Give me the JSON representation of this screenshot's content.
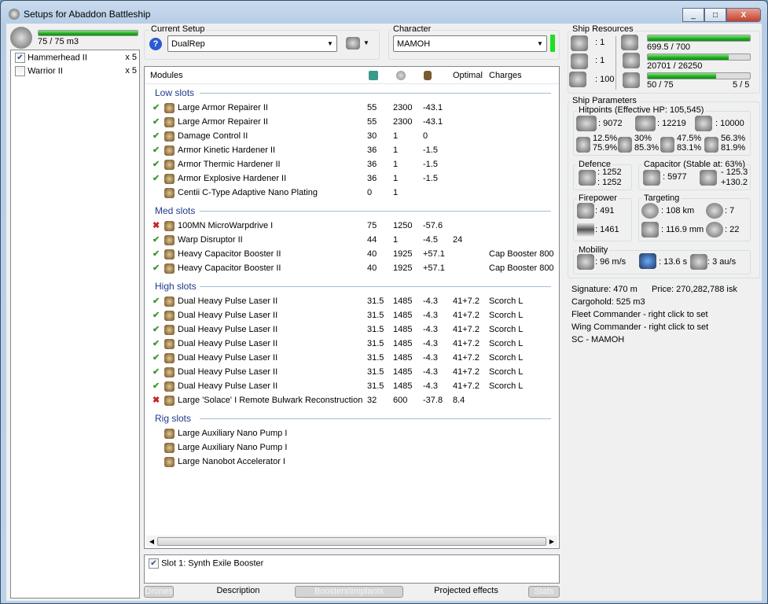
{
  "window": {
    "title": "Setups for Abaddon Battleship",
    "min": "_",
    "max": "□",
    "close": "X"
  },
  "drone_bay": {
    "usage": "75 / 75 m3",
    "fill": 1.0,
    "items": [
      {
        "name": "Hammerhead II",
        "qty": "x 5",
        "checked": true
      },
      {
        "name": "Warrior II",
        "qty": "x 5",
        "checked": false
      }
    ]
  },
  "setup": {
    "label": "Current Setup",
    "value": "DualRep",
    "help": "?"
  },
  "character": {
    "label": "Character",
    "value": "MAMOH"
  },
  "modules": {
    "header": {
      "name": "Modules",
      "optimal": "Optimal",
      "charges": "Charges"
    },
    "sections": [
      {
        "title": "Low slots",
        "rows": [
          {
            "s": "ok",
            "n": "Large Armor Repairer II",
            "cpu": "55",
            "pg": "2300",
            "cap": "-43.1",
            "opt": "",
            "ch": ""
          },
          {
            "s": "ok",
            "n": "Large Armor Repairer II",
            "cpu": "55",
            "pg": "2300",
            "cap": "-43.1",
            "opt": "",
            "ch": ""
          },
          {
            "s": "ok",
            "n": "Damage Control II",
            "cpu": "30",
            "pg": "1",
            "cap": "0",
            "opt": "",
            "ch": ""
          },
          {
            "s": "ok",
            "n": "Armor Kinetic Hardener II",
            "cpu": "36",
            "pg": "1",
            "cap": "-1.5",
            "opt": "",
            "ch": ""
          },
          {
            "s": "ok",
            "n": "Armor Thermic Hardener II",
            "cpu": "36",
            "pg": "1",
            "cap": "-1.5",
            "opt": "",
            "ch": ""
          },
          {
            "s": "ok",
            "n": "Armor Explosive Hardener II",
            "cpu": "36",
            "pg": "1",
            "cap": "-1.5",
            "opt": "",
            "ch": ""
          },
          {
            "s": "",
            "n": "Centii C-Type Adaptive Nano Plating",
            "cpu": "0",
            "pg": "1",
            "cap": "",
            "opt": "",
            "ch": ""
          }
        ]
      },
      {
        "title": "Med slots",
        "rows": [
          {
            "s": "bad",
            "n": "100MN MicroWarpdrive I",
            "cpu": "75",
            "pg": "1250",
            "cap": "-57.6",
            "opt": "",
            "ch": ""
          },
          {
            "s": "ok",
            "n": "Warp Disruptor II",
            "cpu": "44",
            "pg": "1",
            "cap": "-4.5",
            "opt": "24",
            "ch": ""
          },
          {
            "s": "ok",
            "n": "Heavy Capacitor Booster II",
            "cpu": "40",
            "pg": "1925",
            "cap": "+57.1",
            "opt": "",
            "ch": "Cap Booster 800"
          },
          {
            "s": "ok",
            "n": "Heavy Capacitor Booster II",
            "cpu": "40",
            "pg": "1925",
            "cap": "+57.1",
            "opt": "",
            "ch": "Cap Booster 800"
          }
        ]
      },
      {
        "title": "High slots",
        "rows": [
          {
            "s": "ok",
            "n": "Dual Heavy Pulse Laser II",
            "cpu": "31.5",
            "pg": "1485",
            "cap": "-4.3",
            "opt": "41+7.2",
            "ch": "Scorch L"
          },
          {
            "s": "ok",
            "n": "Dual Heavy Pulse Laser II",
            "cpu": "31.5",
            "pg": "1485",
            "cap": "-4.3",
            "opt": "41+7.2",
            "ch": "Scorch L"
          },
          {
            "s": "ok",
            "n": "Dual Heavy Pulse Laser II",
            "cpu": "31.5",
            "pg": "1485",
            "cap": "-4.3",
            "opt": "41+7.2",
            "ch": "Scorch L"
          },
          {
            "s": "ok",
            "n": "Dual Heavy Pulse Laser II",
            "cpu": "31.5",
            "pg": "1485",
            "cap": "-4.3",
            "opt": "41+7.2",
            "ch": "Scorch L"
          },
          {
            "s": "ok",
            "n": "Dual Heavy Pulse Laser II",
            "cpu": "31.5",
            "pg": "1485",
            "cap": "-4.3",
            "opt": "41+7.2",
            "ch": "Scorch L"
          },
          {
            "s": "ok",
            "n": "Dual Heavy Pulse Laser II",
            "cpu": "31.5",
            "pg": "1485",
            "cap": "-4.3",
            "opt": "41+7.2",
            "ch": "Scorch L"
          },
          {
            "s": "ok",
            "n": "Dual Heavy Pulse Laser II",
            "cpu": "31.5",
            "pg": "1485",
            "cap": "-4.3",
            "opt": "41+7.2",
            "ch": "Scorch L"
          },
          {
            "s": "bad",
            "n": "Large 'Solace' I Remote Bulwark Reconstruction",
            "cpu": "32",
            "pg": "600",
            "cap": "-37.8",
            "opt": "8.4",
            "ch": ""
          }
        ]
      },
      {
        "title": "Rig slots",
        "rows": [
          {
            "s": "",
            "n": "Large Auxiliary Nano Pump I",
            "cpu": "",
            "pg": "",
            "cap": "",
            "opt": "",
            "ch": ""
          },
          {
            "s": "",
            "n": "Large Auxiliary Nano Pump I",
            "cpu": "",
            "pg": "",
            "cap": "",
            "opt": "",
            "ch": ""
          },
          {
            "s": "",
            "n": "Large Nanobot Accelerator I",
            "cpu": "",
            "pg": "",
            "cap": "",
            "opt": "",
            "ch": ""
          }
        ]
      }
    ]
  },
  "boosters": {
    "item": "Slot 1: Synth Exile Booster",
    "checked": true
  },
  "tabs": [
    "Drones",
    "Description",
    "Boosters\\Implants",
    "Projected effects",
    "Stats"
  ],
  "resources": {
    "title": "Ship Resources",
    "turrets": ": 1",
    "launchers": ": 1",
    "calibration": ": 100",
    "cpu": "699.5 / 700",
    "cpu_fill": 0.999,
    "pg": "20701 / 26250",
    "pg_fill": 0.789,
    "drones": "50 / 75",
    "drones_fill": 0.667,
    "drone_count": "5 / 5"
  },
  "params": {
    "title": "Ship Parameters",
    "hp_title": "Hitpoints (Effective HP: 105,545)",
    "shield": ": 9072",
    "armor": ": 12219",
    "structure": ": 10000",
    "resists": [
      {
        "a": "12.5%",
        "b": "75.9%"
      },
      {
        "a": "30%",
        "b": "85.3%"
      },
      {
        "a": "47.5%",
        "b": "83.1%"
      },
      {
        "a": "56.3%",
        "b": "81.9%"
      }
    ],
    "defence": {
      "title": "Defence",
      "a": ": 1252",
      "b": ": 1252"
    },
    "capacitor": {
      "title": "Capacitor (Stable at: 63%)",
      "cap": ": 5977",
      "a": "- 125.3",
      "b": "+130.2"
    },
    "firepower": {
      "title": "Firepower",
      "dps": ": 491",
      "volley": ": 1461"
    },
    "targeting": {
      "title": "Targeting",
      "range": ": 108 km",
      "targets": ": 7",
      "scan": ": 116.9 mm",
      "sensor": ": 22"
    },
    "mobility": {
      "title": "Mobility",
      "speed": ": 96 m/s",
      "align": ": 13.6 s",
      "warp": ": 3 au/s"
    },
    "signature": "Signature: 470 m",
    "price": "Price: 270,282,788 isk",
    "cargo": "Cargohold: 525 m3",
    "fleet": "Fleet Commander - right click to set",
    "wing": "Wing Commander - right click to set",
    "sc": "SC - MAMOH"
  }
}
